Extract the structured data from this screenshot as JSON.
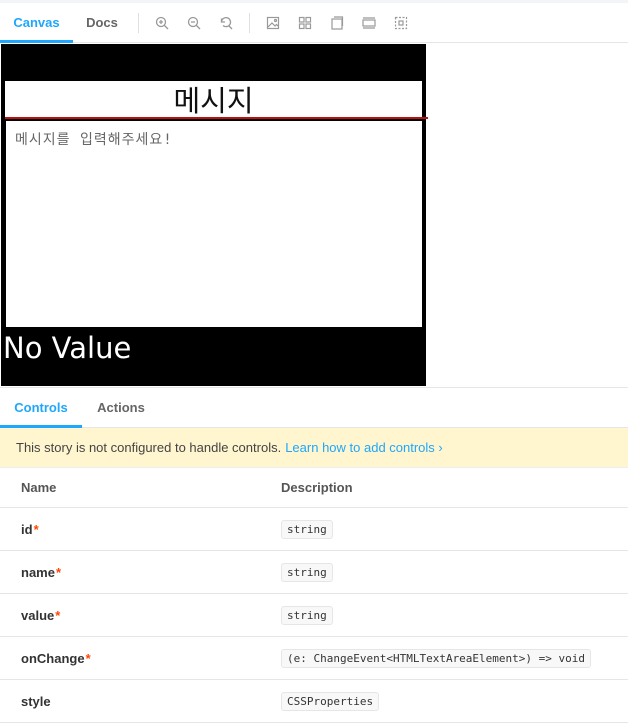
{
  "toolbar": {
    "tabs": [
      {
        "label": "Canvas",
        "active": true
      },
      {
        "label": "Docs",
        "active": false
      }
    ],
    "icons": [
      "zoom-in-icon",
      "zoom-out-icon",
      "reset-zoom-icon",
      "image-background-icon",
      "grid-icon",
      "viewport-icon",
      "measure-icon",
      "outline-icon"
    ]
  },
  "preview": {
    "title": "메시지",
    "textarea_placeholder": "메시지를 입력해주세요!",
    "value_text": "No Value"
  },
  "panel": {
    "tabs": [
      {
        "label": "Controls",
        "active": true
      },
      {
        "label": "Actions",
        "active": false
      }
    ],
    "notice_text": "This story is not configured to handle controls.",
    "notice_link": "Learn how to add controls ›",
    "columns": {
      "name": "Name",
      "description": "Description"
    },
    "rows": [
      {
        "name": "id",
        "required": "*",
        "type": "string"
      },
      {
        "name": "name",
        "required": "*",
        "type": "string"
      },
      {
        "name": "value",
        "required": "*",
        "type": "string"
      },
      {
        "name": "onChange",
        "required": "*",
        "type": "(e: ChangeEvent<HTMLTextAreaElement>) => void"
      },
      {
        "name": "style",
        "required": "",
        "type": "CSSProperties"
      }
    ]
  },
  "colors": {
    "accent": "#1ea7fd",
    "required": "#ff4400",
    "notice_bg": "#fff5cf",
    "stage_bg": "#000000",
    "underline": "#bb1111"
  }
}
